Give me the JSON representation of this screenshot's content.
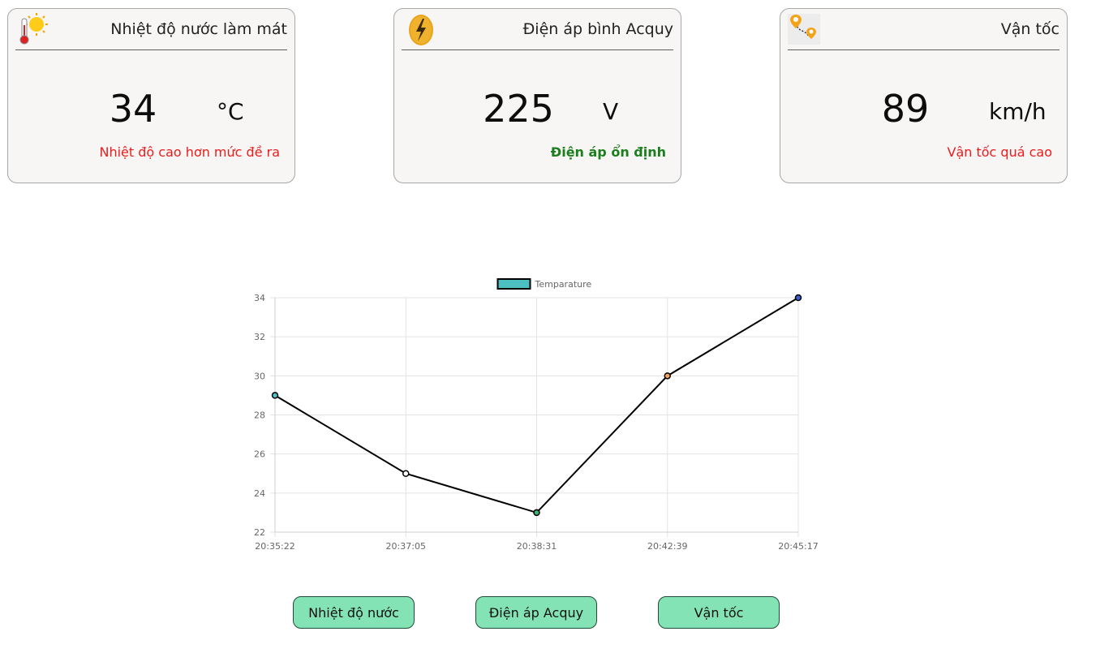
{
  "cards": [
    {
      "title": "Nhiệt độ nước làm mát",
      "value": "34",
      "unit": "°C",
      "status": "Nhiệt độ cao hơn mức đề ra",
      "status_color": "#ea1c1c",
      "icon": "thermometer-sun-icon"
    },
    {
      "title": "Điện áp bình Acquy",
      "value": "225",
      "unit": "V",
      "status": "Điện áp ổn định",
      "status_color": "#1d7e1d",
      "icon": "lightning-bolt-icon"
    },
    {
      "title": "Vận tốc",
      "value": "89",
      "unit": "km/h",
      "status": "Vận tốc quá cao",
      "status_color": "#ea1c1c",
      "icon": "map-route-pins-icon"
    }
  ],
  "chart_data": {
    "type": "line",
    "legend": "Temparature",
    "legend_position": "top-center",
    "legend_color": "#4cbfc0",
    "line_color": "#000000",
    "grid": true,
    "categories": [
      "20:35:22",
      "20:37:05",
      "20:38:31",
      "20:42:39",
      "20:45:17"
    ],
    "series": [
      {
        "name": "Temparature",
        "values": [
          29,
          25,
          23,
          30,
          34
        ],
        "point_colors": [
          "#4cbfc0",
          "#ffffff",
          "#3cb371",
          "#f4a460",
          "#3a5fcd"
        ]
      }
    ],
    "ylim": [
      22,
      34
    ],
    "yticks": [
      22,
      24,
      26,
      28,
      30,
      32,
      34
    ]
  },
  "buttons": {
    "temperature": "Nhiệt độ nước",
    "voltage": "Điện áp Acquy",
    "speed": "Vận tốc"
  }
}
